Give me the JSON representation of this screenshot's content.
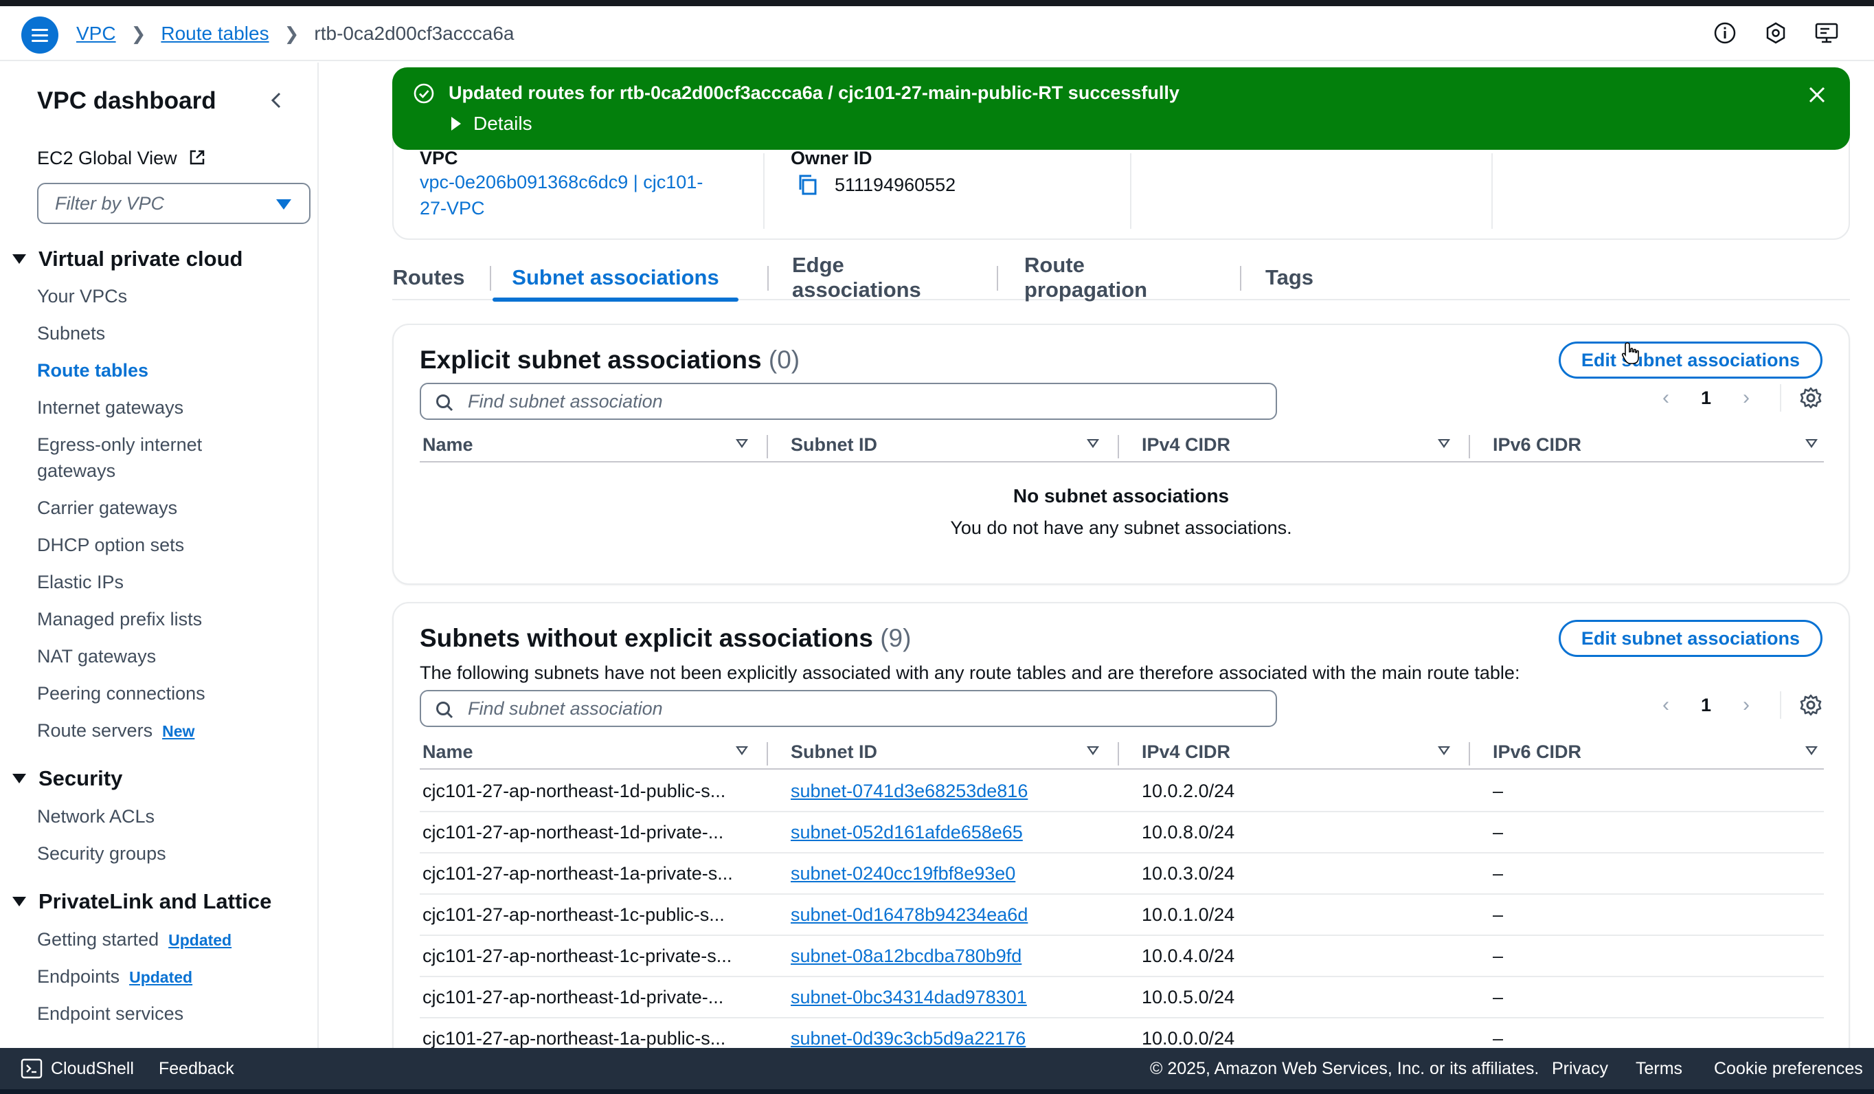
{
  "header": {
    "breadcrumbs": [
      "VPC",
      "Route tables",
      "rtb-0ca2d00cf3accca6a"
    ],
    "icons": [
      "menu-icon",
      "info-icon",
      "notifications-icon",
      "feedback-icon"
    ]
  },
  "sidebar": {
    "title": "VPC dashboard",
    "ec2_global_view": "EC2 Global View",
    "filter_placeholder": "Filter by VPC",
    "sections": {
      "vpc": {
        "label": "Virtual private cloud",
        "items": [
          "Your VPCs",
          "Subnets",
          "Route tables",
          "Internet gateways",
          "Egress-only internet",
          "gateways",
          "Carrier gateways",
          "DHCP option sets",
          "Elastic IPs",
          "Managed prefix lists",
          "NAT gateways",
          "Peering connections",
          "Route servers"
        ],
        "route_servers_badge": "New"
      },
      "security": {
        "label": "Security",
        "items": [
          "Network ACLs",
          "Security groups"
        ]
      },
      "privatelink": {
        "label": "PrivateLink and Lattice",
        "items": [
          "Getting started",
          "Endpoints",
          "Endpoint services"
        ],
        "badge": "Updated"
      }
    }
  },
  "flash": {
    "message": "Updated routes for rtb-0ca2d00cf3accca6a / cjc101-27-main-public-RT successfully",
    "details": "Details",
    "color": "#037f0c"
  },
  "details_card": {
    "vpc_label": "VPC",
    "vpc_value_line1": "vpc-0e206b091368c6dc9 | cjc101-",
    "vpc_value_line2": "27-VPC",
    "owner_label": "Owner ID",
    "owner_value": "511194960552"
  },
  "tabs": [
    "Routes",
    "Subnet associations",
    "Edge associations",
    "Route propagation",
    "Tags"
  ],
  "explicit": {
    "title": "Explicit subnet associations",
    "count": "(0)",
    "edit_button": "Edit subnet associations",
    "search_placeholder": "Find subnet association",
    "page": "1",
    "columns": [
      "Name",
      "Subnet ID",
      "IPv4 CIDR",
      "IPv6 CIDR"
    ],
    "empty_title": "No subnet associations",
    "empty_desc": "You do not have any subnet associations."
  },
  "without": {
    "title": "Subnets without explicit associations",
    "count": "(9)",
    "edit_button": "Edit subnet associations",
    "description": "The following subnets have not been explicitly associated with any route tables and are therefore associated with the main route table:",
    "search_placeholder": "Find subnet association",
    "page": "1",
    "columns": [
      "Name",
      "Subnet ID",
      "IPv4 CIDR",
      "IPv6 CIDR"
    ],
    "rows": [
      {
        "name": "cjc101-27-ap-northeast-1d-public-s...",
        "subnet": "subnet-0741d3e68253de816",
        "ipv4": "10.0.2.0/24",
        "ipv6": "–"
      },
      {
        "name": "cjc101-27-ap-northeast-1d-private-...",
        "subnet": "subnet-052d161afde658e65",
        "ipv4": "10.0.8.0/24",
        "ipv6": "–"
      },
      {
        "name": "cjc101-27-ap-northeast-1a-private-s...",
        "subnet": "subnet-0240cc19fbf8e93e0",
        "ipv4": "10.0.3.0/24",
        "ipv6": "–"
      },
      {
        "name": "cjc101-27-ap-northeast-1c-public-s...",
        "subnet": "subnet-0d16478b94234ea6d",
        "ipv4": "10.0.1.0/24",
        "ipv6": "–"
      },
      {
        "name": "cjc101-27-ap-northeast-1c-private-s...",
        "subnet": "subnet-08a12bcdba780b9fd",
        "ipv4": "10.0.4.0/24",
        "ipv6": "–"
      },
      {
        "name": "cjc101-27-ap-northeast-1d-private-...",
        "subnet": "subnet-0bc34314dad978301",
        "ipv4": "10.0.5.0/24",
        "ipv6": "–"
      },
      {
        "name": "cjc101-27-ap-northeast-1a-public-s...",
        "subnet": "subnet-0d39c3cb5d9a22176",
        "ipv4": "10.0.0.0/24",
        "ipv6": "–"
      }
    ]
  },
  "footer": {
    "cloudshell": "CloudShell",
    "feedback": "Feedback",
    "copyright": "© 2025, Amazon Web Services, Inc. or its affiliates.",
    "privacy": "Privacy",
    "terms": "Terms",
    "cookies": "Cookie preferences"
  },
  "colors": {
    "accent": "#0972d3",
    "success": "#037f0c",
    "footer_bg": "#232f3e"
  }
}
